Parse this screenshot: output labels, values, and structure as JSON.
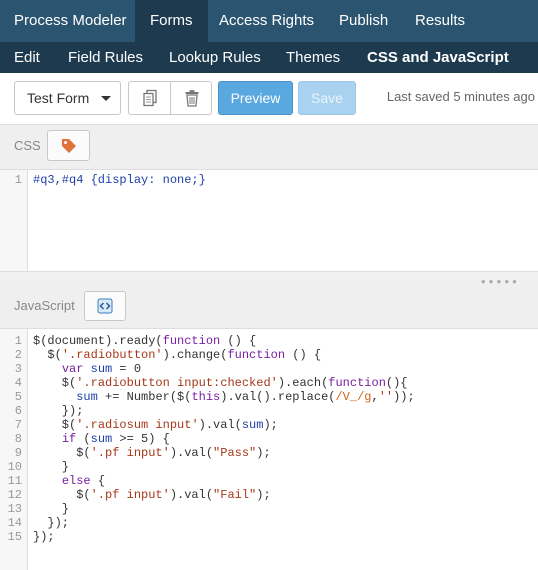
{
  "topnav": {
    "items": [
      "Process Modeler",
      "Forms",
      "Access Rights",
      "Publish",
      "Results"
    ],
    "active": "Forms"
  },
  "subnav": {
    "items": [
      "Edit",
      "Field Rules",
      "Lookup Rules",
      "Themes",
      "CSS and JavaScript"
    ],
    "active": "CSS and JavaScript"
  },
  "toolbar": {
    "form_select": "Test Form",
    "copy_icon": "copy-icon",
    "delete_icon": "trash-icon",
    "preview_label": "Preview",
    "save_label": "Save",
    "last_saved": "Last saved 5 minutes ago"
  },
  "css_panel": {
    "label": "CSS",
    "tag_icon": "tag-icon",
    "lines": [
      "#q3,#q4 {display: none;}"
    ]
  },
  "js_panel": {
    "label": "JavaScript",
    "code_icon": "code-icon",
    "lines": [
      "$(document).ready(function () {",
      "  $('.radiobutton').change(function () {",
      "    var sum = 0",
      "    $('.radiobutton input:checked').each(function(){",
      "      sum += Number($(this).val().replace(/V_/g,''));",
      "    });",
      "    $('.radiosum input').val(sum);",
      "    if (sum >= 5) {",
      "      $('.pf input').val(\"Pass\");",
      "    }",
      "    else {",
      "      $('.pf input').val(\"Fail\");",
      "    }",
      "  });",
      "});"
    ]
  },
  "colors": {
    "topnav_bg": "#2b5470",
    "subnav_bg": "#1d3a4e",
    "preview_button": "#5aa8e0",
    "save_button_disabled": "#a9d2f1",
    "tag_icon": "#e0733a"
  }
}
